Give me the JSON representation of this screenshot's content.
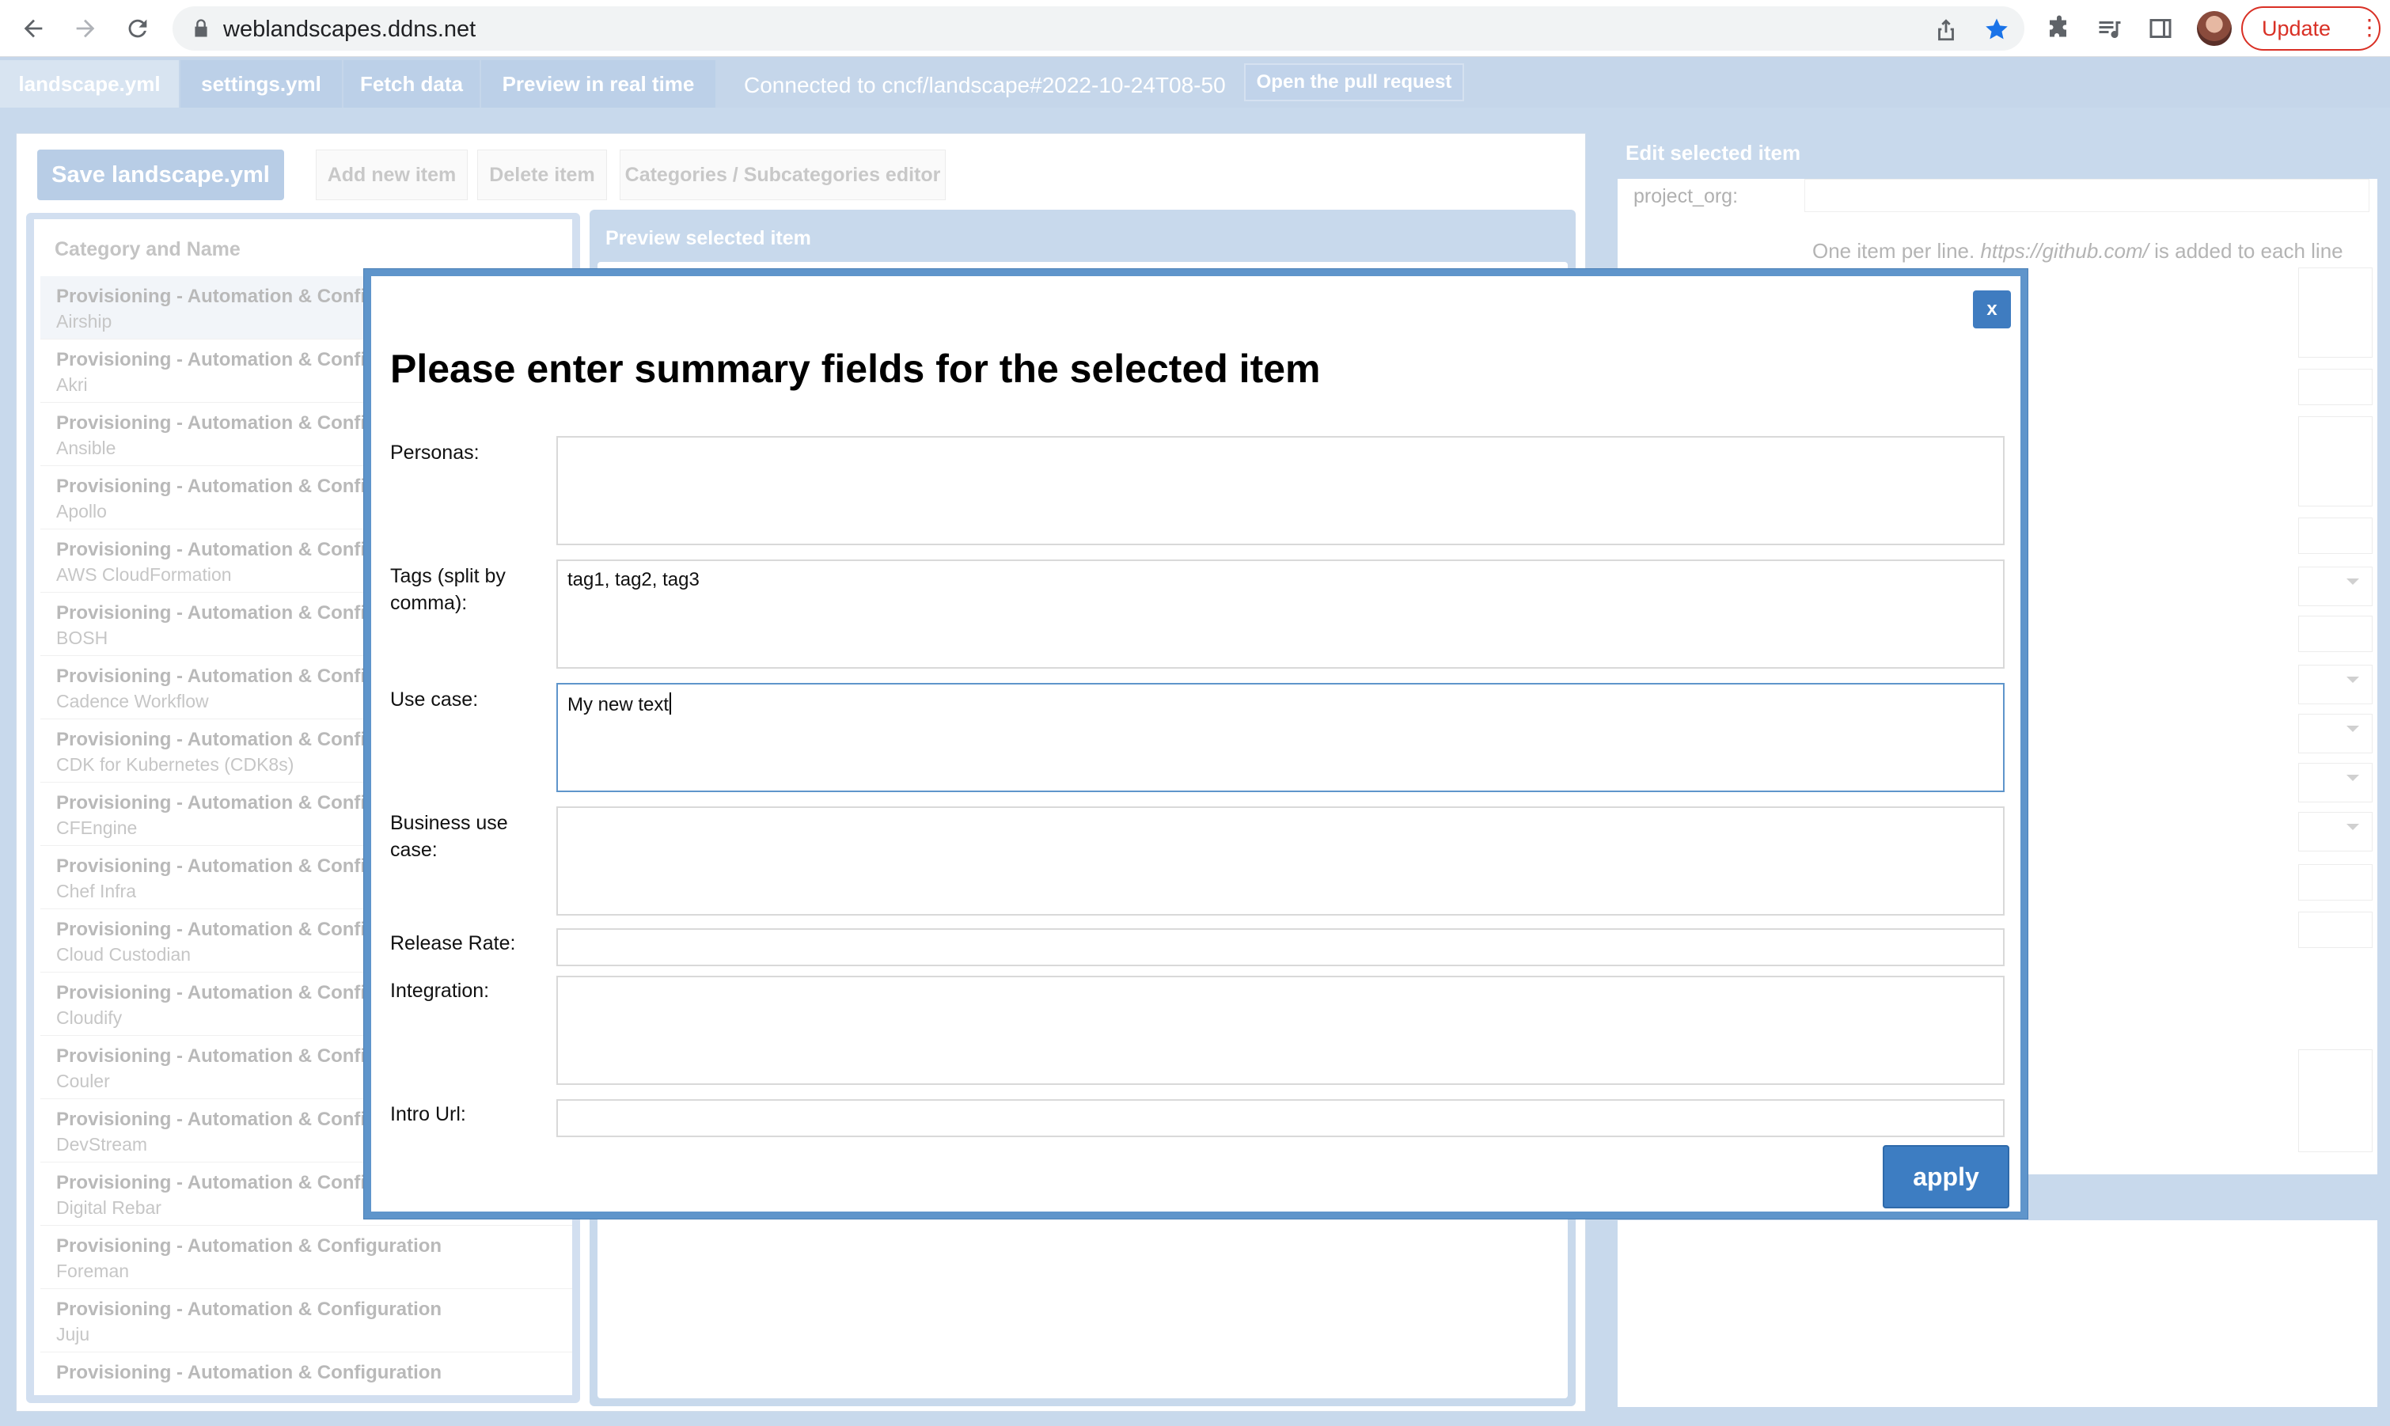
{
  "browser": {
    "url": "weblandscapes.ddns.net",
    "update_label": "Update"
  },
  "app_tabs": {
    "items": [
      {
        "label": "landscape.yml"
      },
      {
        "label": "settings.yml"
      },
      {
        "label": "Fetch data"
      },
      {
        "label": "Preview in real time"
      }
    ],
    "connected_text": "Connected to cncf/landscape#2022-10-24T08-50",
    "pull_request_label": "Open the pull request"
  },
  "toolbar": {
    "save_label": "Save landscape.yml",
    "add_label": "Add new item",
    "delete_label": "Delete item",
    "categories_label": "Categories / Subcategories editor"
  },
  "list": {
    "header": "Category and Name",
    "items": [
      {
        "category": "Provisioning - Automation & Confi",
        "name": "Airship"
      },
      {
        "category": "Provisioning - Automation & Confi",
        "name": "Akri"
      },
      {
        "category": "Provisioning - Automation & Confi",
        "name": "Ansible"
      },
      {
        "category": "Provisioning - Automation & Confi",
        "name": "Apollo"
      },
      {
        "category": "Provisioning - Automation & Confi",
        "name": "AWS CloudFormation"
      },
      {
        "category": "Provisioning - Automation & Confi",
        "name": "BOSH"
      },
      {
        "category": "Provisioning - Automation & Confi",
        "name": "Cadence Workflow"
      },
      {
        "category": "Provisioning - Automation & Confi",
        "name": "CDK for Kubernetes (CDK8s)"
      },
      {
        "category": "Provisioning - Automation & Confi",
        "name": "CFEngine"
      },
      {
        "category": "Provisioning - Automation & Confi",
        "name": "Chef Infra"
      },
      {
        "category": "Provisioning - Automation & Confi",
        "name": "Cloud Custodian"
      },
      {
        "category": "Provisioning - Automation & Confi",
        "name": "Cloudify"
      },
      {
        "category": "Provisioning - Automation & Confi",
        "name": "Couler"
      },
      {
        "category": "Provisioning - Automation & Confi",
        "name": "DevStream"
      },
      {
        "category": "Provisioning - Automation & Confi",
        "name": "Digital Rebar"
      },
      {
        "category": "Provisioning - Automation & Configuration",
        "name": "Foreman"
      },
      {
        "category": "Provisioning - Automation & Configuration",
        "name": "Juju"
      },
      {
        "category": "Provisioning - Automation & Configuration",
        "name": ""
      }
    ]
  },
  "preview": {
    "title": "Preview selected item"
  },
  "edit_panel": {
    "title": "Edit selected item",
    "project_org_label": "project_org:",
    "hint_prefix": "One item per line. ",
    "hint_url": "https://github.com/",
    "hint_suffix": " is added to each line"
  },
  "modal": {
    "close_label": "x",
    "title": "Please enter summary fields for the selected item",
    "fields": {
      "personas": {
        "label": "Personas:",
        "value": ""
      },
      "tags": {
        "label": "Tags (split by comma):",
        "value": "tag1, tag2, tag3"
      },
      "use_case": {
        "label": "Use case:",
        "value": "My new text"
      },
      "business_use_case": {
        "label": "Business use case:",
        "value": ""
      },
      "release_rate": {
        "label": "Release Rate:",
        "value": ""
      },
      "integration": {
        "label": "Integration:",
        "value": ""
      },
      "intro_url": {
        "label": "Intro Url:",
        "value": ""
      }
    },
    "apply_label": "apply"
  },
  "colors": {
    "accent": "#3d7dc2",
    "modal_border": "#5f95cb",
    "app_bg": "#c8d9ec",
    "update_red": "#d93025"
  }
}
